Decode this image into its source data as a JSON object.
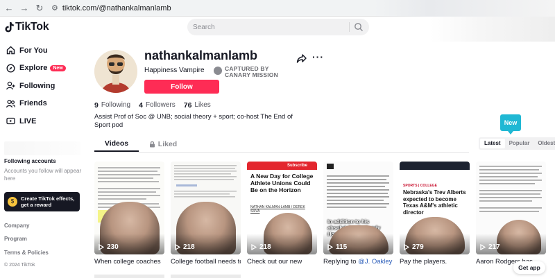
{
  "browser": {
    "url": "tiktok.com/@nathankalmanlamb"
  },
  "header": {
    "logo_text": "TikTok",
    "search_placeholder": "Search"
  },
  "sidebar": {
    "items": [
      {
        "label": "For You",
        "icon": "home-icon"
      },
      {
        "label": "Explore",
        "icon": "compass-icon",
        "badge": "New"
      },
      {
        "label": "Following",
        "icon": "person-add-icon"
      },
      {
        "label": "Friends",
        "icon": "friends-icon"
      },
      {
        "label": "LIVE",
        "icon": "live-icon"
      }
    ],
    "following_title": "Following accounts",
    "following_sub": "Accounts you follow will appear here",
    "effects_text": "Create TikTok effects, get a reward",
    "footer_links": [
      "Company",
      "Program",
      "Terms & Policies"
    ],
    "copyright": "© 2024 TikTok"
  },
  "profile": {
    "username": "nathankalmanlamb",
    "nickname": "Happiness Vampire",
    "captured_line1": "CAPTURED BY",
    "captured_line2": "CANARY MISSION",
    "follow_label": "Follow",
    "following_count": "9",
    "following_label": "Following",
    "followers_count": "4",
    "followers_label": "Followers",
    "likes_count": "76",
    "likes_label": "Likes",
    "bio": "Assist Prof of Soc @ UNB; social theory + sport; co-host The End of Sport pod"
  },
  "tabs": {
    "videos": "Videos",
    "liked": "Liked"
  },
  "sort": {
    "tooltip": "New",
    "options": [
      "Latest",
      "Popular",
      "Oldest"
    ],
    "selected": "Latest"
  },
  "videos": [
    {
      "plays": "230",
      "caption": "When college coaches",
      "style": "doc"
    },
    {
      "plays": "218",
      "caption": "College football needs to",
      "style": "doc"
    },
    {
      "plays": "218",
      "caption": "Check out our new",
      "style": "red",
      "headline": "A New Day for College Athlete Unions Could Be on the Horizon",
      "byline": "NATHAN KALMAN-LAMB / DEREK SILVA",
      "subscribe": "Subscribe"
    },
    {
      "plays": "115",
      "caption": "Replying to ",
      "mention": "@J. Oakley",
      "style": "doc",
      "overlay": "In addition to his absolutely vile Sandy Hook denialism"
    },
    {
      "plays": "279",
      "caption": "Pay the players.",
      "style": "news",
      "headline": "Nebraska's Trev Alberts expected to become Texas A&M's athletic director",
      "section": "SPORTS | COLLEGE"
    },
    {
      "plays": "217",
      "caption": "Aaron Rodgers has",
      "style": "doc"
    }
  ],
  "get_app": "Get app"
}
